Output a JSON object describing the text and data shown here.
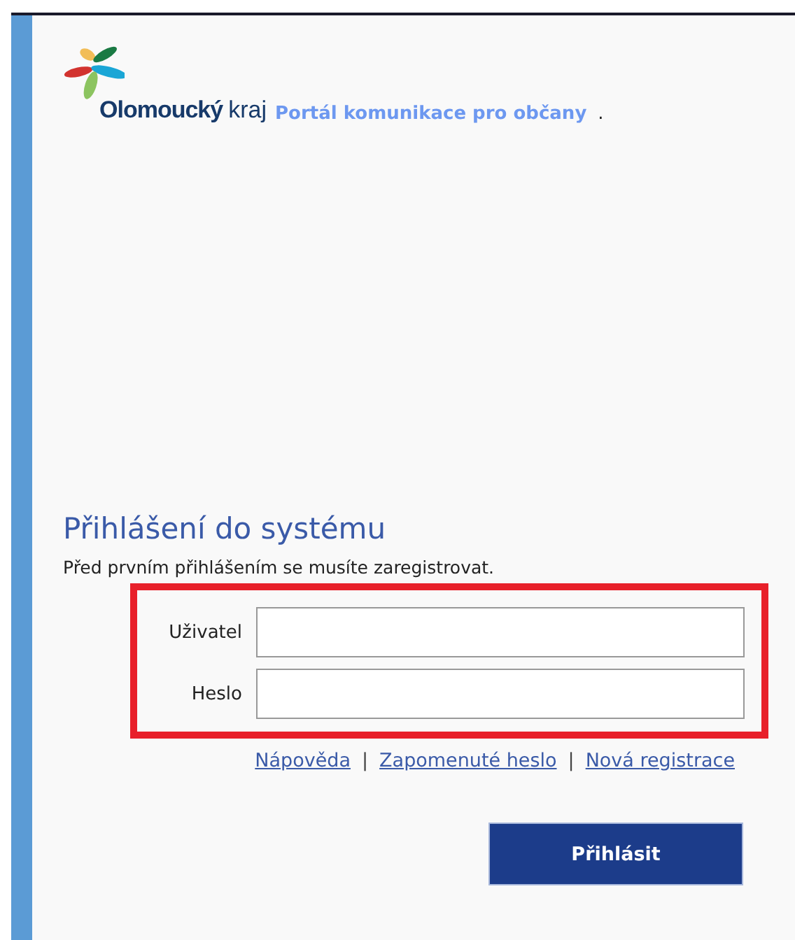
{
  "header": {
    "logo_bold": "Olomoucký",
    "logo_light": "kraj",
    "tagline": "Portál komunikace pro občany",
    "tagline_suffix": "."
  },
  "login": {
    "title": "Přihlášení do systému",
    "note": "Před prvním přihlášením se musíte zaregistrovat.",
    "fields": [
      {
        "label": "Uživatel"
      },
      {
        "label": "Heslo"
      }
    ],
    "link_separator": "|",
    "highlighted": true,
    "links": [
      "Nápověda",
      "Zapomenuté heslo",
      "Nová registrace"
    ],
    "submit": "Přihlásit"
  }
}
